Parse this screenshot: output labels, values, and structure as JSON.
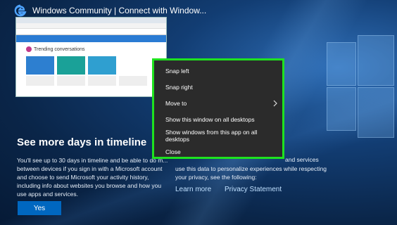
{
  "window": {
    "title": "Windows Community | Connect with Window..."
  },
  "thumbnail": {
    "heading": "Trending conversations",
    "card_colors": [
      "#2d7fd0",
      "#1aa198",
      "#2f9fd0"
    ]
  },
  "oobe": {
    "heading": "See more days in timeline",
    "body_left": "You'll see up to 30 days in timeline and be able to do m... between devices if you sign in with a Microsoft account and choose to send Microsoft your activity history, including info about websites you browse and how you use apps and services.",
    "body_right_fragment": "and services",
    "body_right": "use this data to personalize experiences while respecting your privacy, see the following:",
    "learn_more": "Learn more",
    "privacy_statement": "Privacy Statement",
    "yes_button": "Yes"
  },
  "context_menu": {
    "items": [
      {
        "label": "Snap left"
      },
      {
        "label": "Snap right"
      },
      {
        "label": "Move to",
        "has_submenu": true
      },
      {
        "label": "Show this window on all desktops"
      },
      {
        "label": "Show windows from this app on all desktops"
      },
      {
        "label": "Close"
      }
    ],
    "highlight_color": "#1fe21f"
  }
}
